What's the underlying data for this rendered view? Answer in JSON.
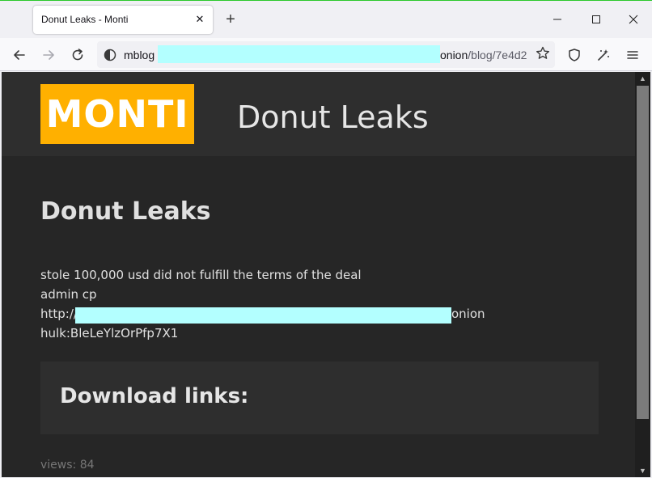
{
  "browser": {
    "tab_title": "Donut Leaks - Monti",
    "tab_close_glyph": "✕",
    "new_tab_glyph": "+",
    "url_host_start": "mblog",
    "url_host_end": "onion",
    "url_path": "/blog/7e4d2",
    "icons": [
      "back-icon",
      "forward-icon",
      "reload-icon",
      "site-info-icon",
      "star-icon",
      "shield-icon",
      "extensions-icon",
      "menu-icon"
    ]
  },
  "site": {
    "logo_text": "MONTI",
    "site_title": "Donut Leaks",
    "logo_color": "#ffb000",
    "background": "#262626"
  },
  "post": {
    "title": "Donut Leaks",
    "lines": [
      "stole 100,000 usd did not fulfill the terms of the deal",
      "admin cp",
      "http://",
      "hulk:BleLeYlzOrPfp7X1"
    ],
    "line3_suffix": "onion",
    "download_heading": "Download links:",
    "views": "views: 84"
  },
  "colors": {
    "redaction": "#b3ffff",
    "accent_border": "#2bc82b"
  }
}
